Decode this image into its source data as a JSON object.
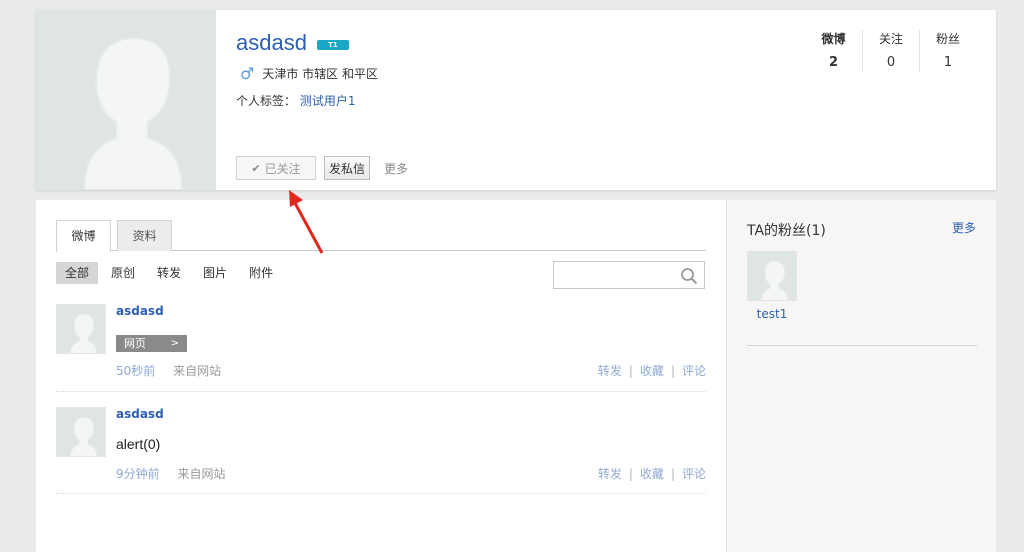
{
  "profile": {
    "username": "asdasd",
    "level_badge": "T1",
    "gender_icon": "♂",
    "location": "天津市 市辖区 和平区",
    "tags_label": "个人标签：",
    "tag": "测试用户1",
    "followed_label": "已关注",
    "message_label": "发私信",
    "more_label": "更多"
  },
  "stats": [
    {
      "label": "微博",
      "value": "2"
    },
    {
      "label": "关注",
      "value": "0"
    },
    {
      "label": "粉丝",
      "value": "1"
    }
  ],
  "tabs": [
    {
      "label": "微博",
      "active": true
    },
    {
      "label": "资料",
      "active": false
    }
  ],
  "filters": [
    "全部",
    "原创",
    "转发",
    "图片",
    "附件"
  ],
  "search": {
    "placeholder": ""
  },
  "posts": [
    {
      "author": "asdasd",
      "badge": "网页",
      "time": "50秒前",
      "source": "来自网站",
      "actions": [
        "转发",
        "收藏",
        "评论"
      ]
    },
    {
      "author": "asdasd",
      "text": "alert(0)",
      "time": "9分钟前",
      "source": "来自网站",
      "actions": [
        "转发",
        "收藏",
        "评论"
      ]
    }
  ],
  "sidebar": {
    "title": "TA的粉丝(1)",
    "more": "更多",
    "fans": [
      {
        "name": "test1"
      }
    ]
  },
  "colors": {
    "link": "#2e5fb3",
    "meta_link": "#8fa9d4",
    "badge": "#1ea6c8",
    "arrow": "#e0281e"
  }
}
